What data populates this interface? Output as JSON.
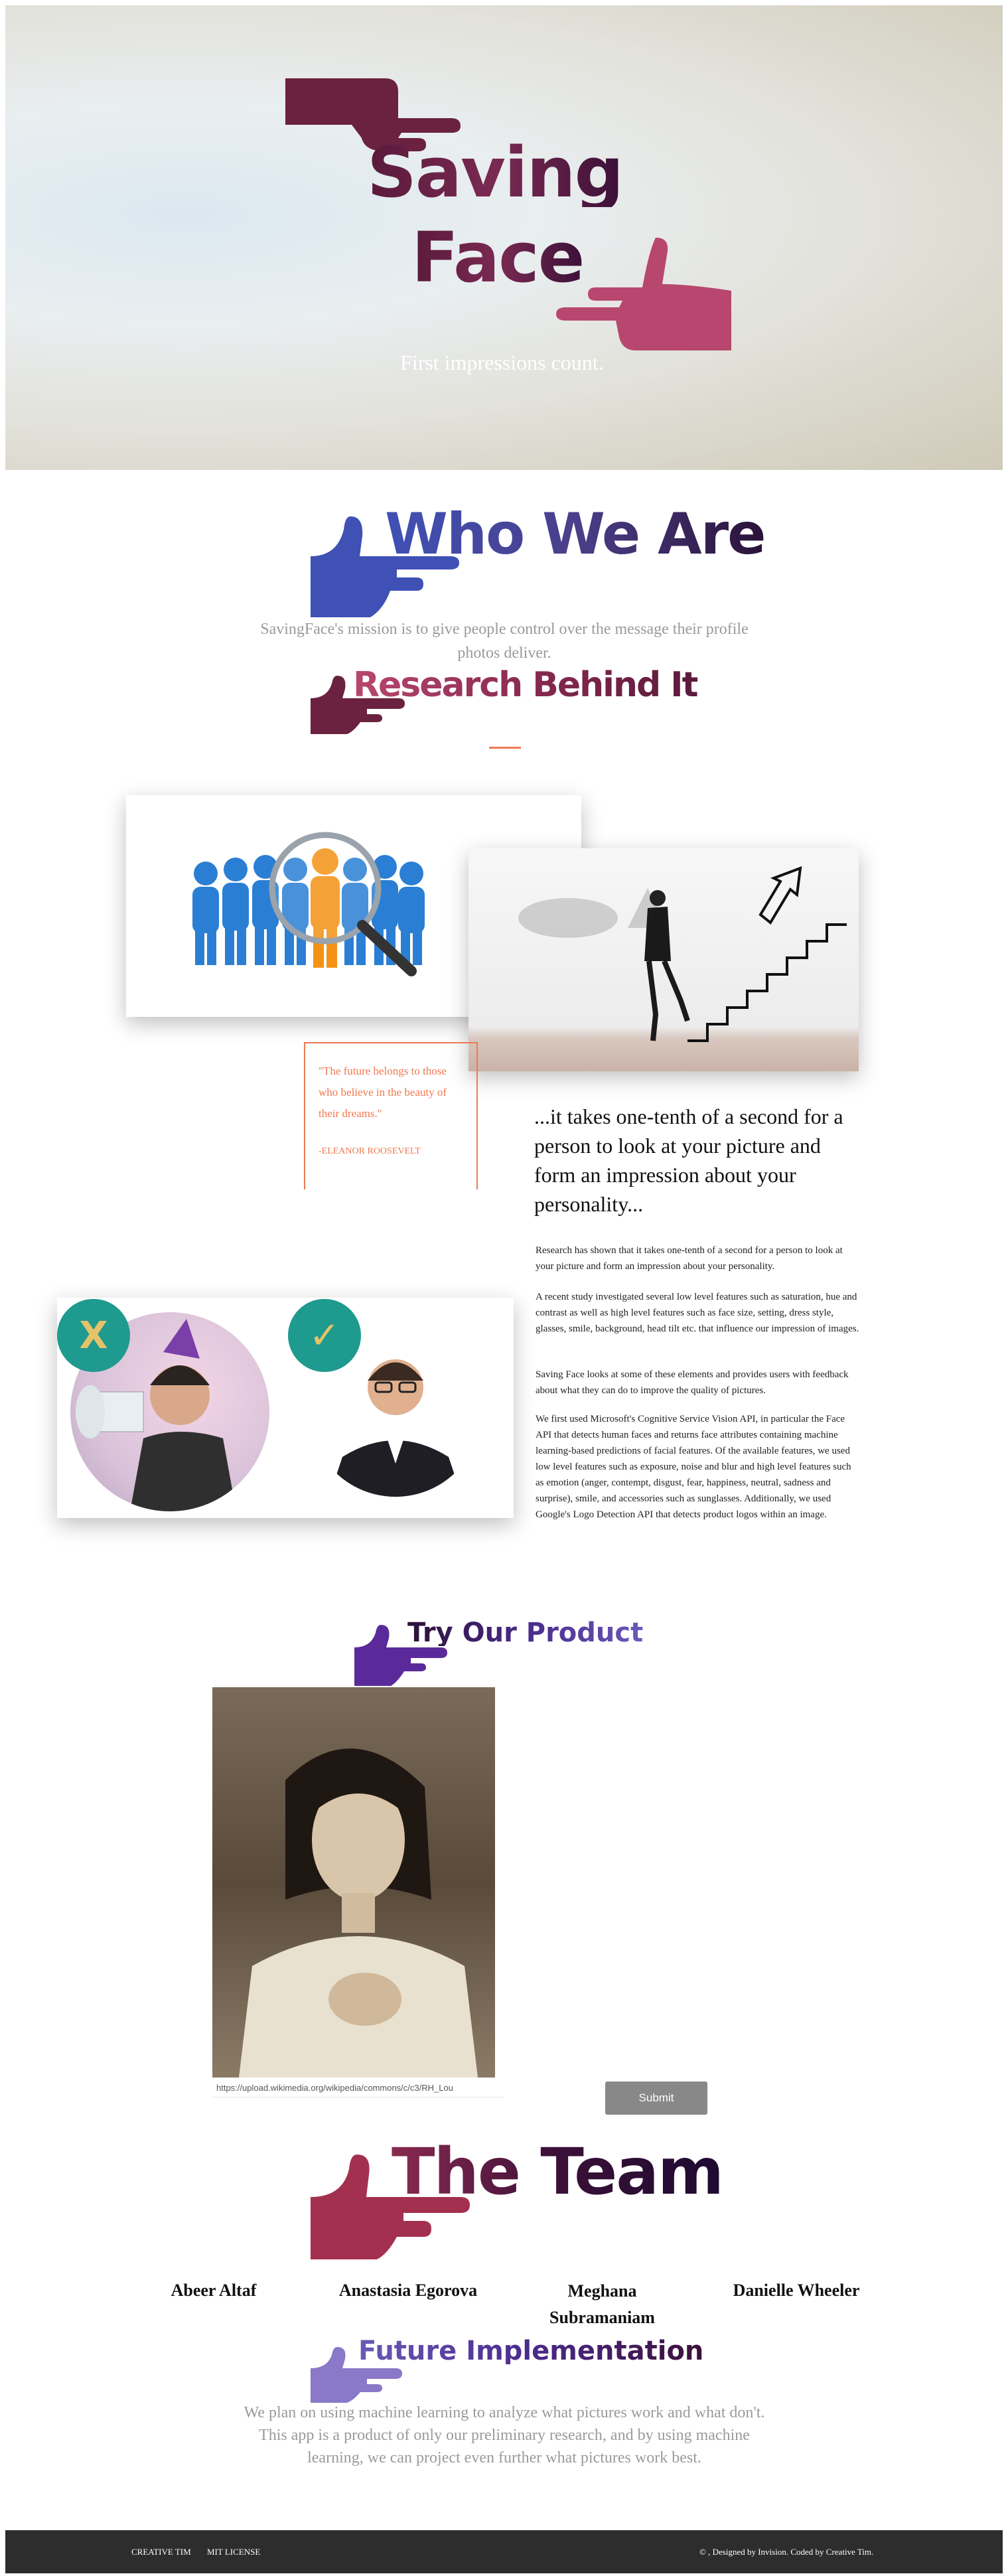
{
  "hero": {
    "title_line1": "Saving",
    "title_line2": "Face",
    "tagline": "First impressions count."
  },
  "who": {
    "title": "Who We Are",
    "mission": "SavingFace's mission is to give people control over the message their profile photos deliver."
  },
  "research": {
    "title": "Research Behind It",
    "quote": "\"The future belongs to those who believe in the beauty of their dreams.\"",
    "quote_author": "-ELEANOR ROOSEVELT",
    "lead": "...it takes one-tenth of a second for a person to look at your picture and form an impression about your personality...",
    "p1": "Research has shown that it takes one-tenth of a second for a person to look at your picture and form an impression about your personality.",
    "p2": "A recent study investigated several low level features such as saturation, hue and contrast as well as high level features such as face size, setting, dress style, glasses, smile, background, head tilt etc. that influence our impression of images.",
    "p3": "Saving Face looks at some of these elements and provides users with feedback about what they can do to improve the quality of pictures.",
    "p4": "We first used Microsoft's Cognitive Service Vision API, in particular the Face API that detects human faces and returns face attributes containing machine learning-based predictions of facial features. Of the available features, we used low level features such as exposure, noise and blur and high level features such as emotion (anger, contempt, disgust, fear, happiness, neutral, sadness and surprise), smile, and accessories such as sunglasses. Additionally, we used Google's Logo Detection API that detects product logos within an image.",
    "bad_mark": "X",
    "good_mark": "✓"
  },
  "product": {
    "title": "Try Our Product",
    "url_value": "https://upload.wikimedia.org/wikipedia/commons/c/c3/RH_Lou",
    "submit_label": "Submit"
  },
  "team": {
    "title": "The Team",
    "members": [
      "Abeer Altaf",
      "Anastasia Egorova",
      "Meghana Subramaniam",
      "Danielle Wheeler"
    ]
  },
  "future": {
    "title": "Future Implementation",
    "text": "We plan on using machine learning to analyze what pictures work and what don't. This app is a product of only our preliminary research, and by using machine learning, we can project even further what pictures work best."
  },
  "footer": {
    "link1": "CREATIVE TIM",
    "link2": "MIT LICENSE",
    "copyright": "© , Designed by Invision. Coded by Creative Tim."
  },
  "colors": {
    "accent_orange": "#f0794f",
    "hand_burgundy": "#6b2140",
    "hand_pink": "#b8476f",
    "hand_blue": "#3f51b5",
    "hand_purple": "#5b2a9a",
    "hand_lavender": "#8a78c8",
    "submit_gray": "#888888",
    "footer_bg": "#2d2d2d"
  }
}
